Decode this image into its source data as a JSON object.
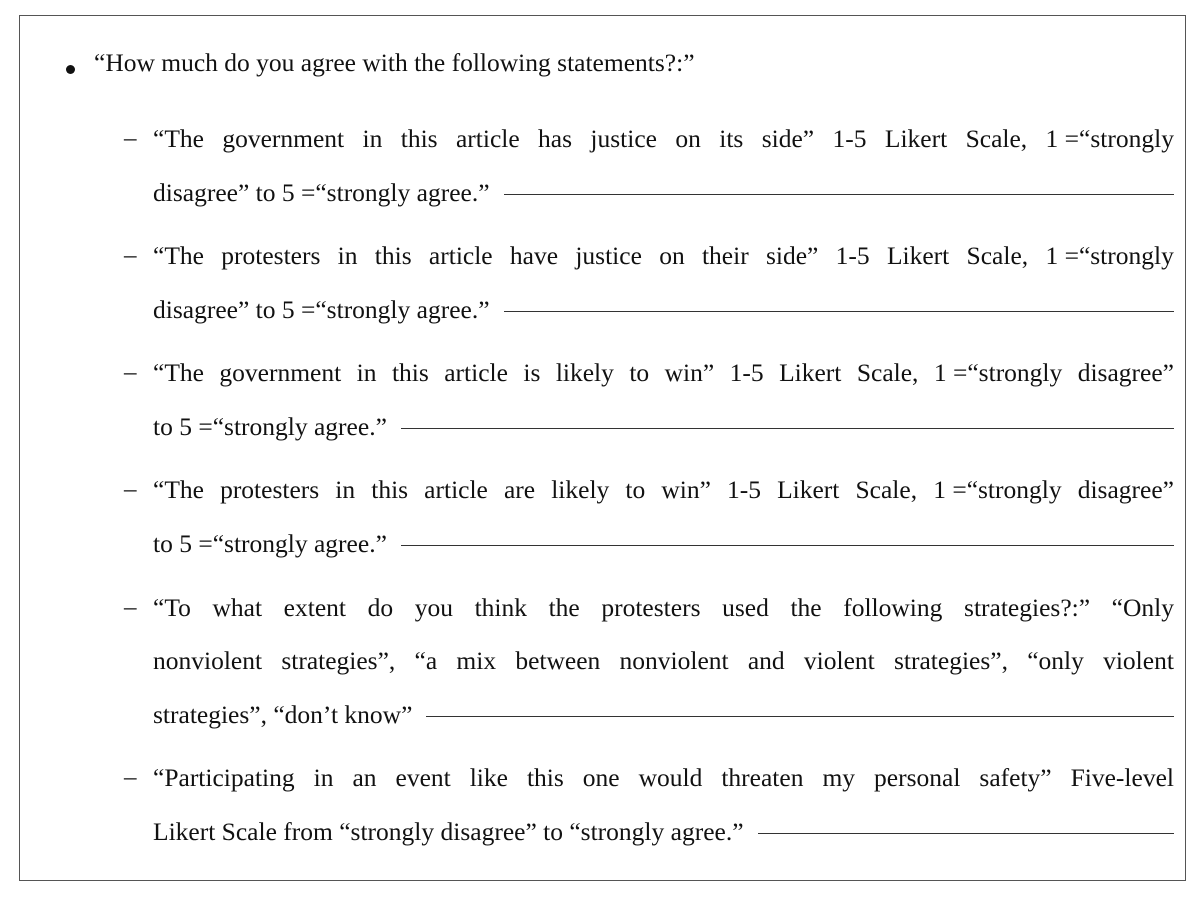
{
  "main": {
    "question": "“How much do you agree with the following statements?:”",
    "items": [
      {
        "line1": [
          "“The",
          "government",
          "in",
          "this",
          "article",
          "has",
          "justice",
          "on",
          "its",
          "side”",
          "1-5",
          "Likert",
          "Scale,",
          "1 =“strongly"
        ],
        "line2": "disagree” to 5 =“strongly agree.”"
      },
      {
        "line1": [
          "“The",
          "protesters",
          "in",
          "this",
          "article",
          "have",
          "justice",
          "on",
          "their",
          "side”",
          "1-5",
          "Likert",
          "Scale,",
          "1 =“strongly"
        ],
        "line2": "disagree” to 5 =“strongly agree.”"
      },
      {
        "line1": [
          "“The",
          "government",
          "in",
          "this",
          "article",
          "is",
          "likely",
          "to",
          "win”",
          "1-5",
          "Likert",
          "Scale,",
          "1 =“strongly",
          "disagree”"
        ],
        "line2": "to 5 =“strongly agree.”"
      },
      {
        "line1": [
          "“The",
          "protesters",
          "in",
          "this",
          "article",
          "are",
          "likely",
          "to",
          "win”",
          "1-5",
          "Likert",
          "Scale,",
          "1 =“strongly",
          "disagree”"
        ],
        "line2": "to 5 =“strongly agree.”"
      },
      {
        "line1": [
          "“To",
          "what",
          "extent",
          "do",
          "you",
          "think",
          "the",
          "protesters",
          "used",
          "the",
          "following",
          "strategies?:”",
          "“Only"
        ],
        "line2_words": [
          "nonviolent",
          "strategies”,",
          "“a",
          "mix",
          "between",
          "nonviolent",
          "and",
          "violent",
          "strategies”,",
          "“only",
          "violent"
        ],
        "line3": "strategies”, “don’t know”"
      },
      {
        "line1": [
          "“Participating",
          "in",
          "an",
          "event",
          "like",
          "this",
          "one",
          "would",
          "threaten",
          "my",
          "personal",
          "safety”",
          "Five-level"
        ],
        "line2": "Likert Scale from “strongly disagree” to “strongly agree.”"
      }
    ],
    "dash": "–"
  }
}
